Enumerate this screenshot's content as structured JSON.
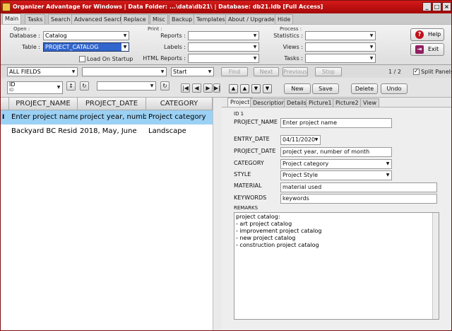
{
  "window": {
    "title": "Organizer Advantage for Windows | Data Folder: ...\\data\\db21\\ | Database: db21.ldb [Full Access]"
  },
  "menu_tabs": [
    "Main",
    "Tasks",
    "Search",
    "Advanced Search",
    "Replace",
    "Misc",
    "Backup",
    "Templates",
    "About / Upgrade",
    "Hide"
  ],
  "ribbon": {
    "open": {
      "caption": "Open :",
      "database_label": "Database :",
      "database_value": "Catalog",
      "table_label": "Table :",
      "table_value": "PROJECT_CATALOG",
      "load_on_startup_label": "Load On Startup",
      "load_on_startup_checked": false
    },
    "print": {
      "caption": "Print :",
      "reports_label": "Reports :",
      "labels_label": "Labels :",
      "html_reports_label": "HTML Reports :"
    },
    "process": {
      "caption": "Process :",
      "statistics_label": "Statistics :",
      "views_label": "Views :",
      "tasks_label": "Tasks :"
    },
    "help_label": "Help",
    "exit_label": "Exit"
  },
  "search": {
    "field": "ALL FIELDS",
    "term": "",
    "mode": "Start",
    "find_label": "Find",
    "next_label": "Next",
    "previous_label": "Previous",
    "stop_label": "Stop",
    "record_counter": "1 / 2",
    "split_panels_label": "Split Panels",
    "split_panels_checked": true
  },
  "left_toolbar": {
    "sort_field": "ID",
    "sort_field_sub": "ID",
    "filter_value": ""
  },
  "grid": {
    "columns": [
      "PROJECT_NAME",
      "PROJECT_DATE",
      "CATEGORY"
    ],
    "rows": [
      {
        "marker": "I",
        "cells": [
          "Enter project name",
          "project year, number",
          "Project category"
        ],
        "selected": true
      },
      {
        "marker": "",
        "cells": [
          "Backyard BC Residen",
          "2018, May, June",
          "Landscape"
        ],
        "selected": false
      }
    ]
  },
  "record_toolbar": {
    "new_label": "New",
    "save_label": "Save",
    "delete_label": "Delete",
    "undo_label": "Undo"
  },
  "form_tabs": [
    "Project",
    "Description",
    "Details",
    "Picture1",
    "Picture2",
    "View"
  ],
  "form": {
    "id_label": "ID 1",
    "project_name_label": "PROJECT_NAME",
    "project_name_value": "Enter project name",
    "entry_date_label": "ENTRY_DATE",
    "entry_date_value": "04/11/2020",
    "project_date_label": "PROJECT_DATE",
    "project_date_value": "project year, number of month",
    "category_label": "CATEGORY",
    "category_value": "Project category",
    "style_label": "STYLE",
    "style_value": "Project Style",
    "material_label": "MATERIAL",
    "material_value": "material used",
    "keywords_label": "KEYWORDS",
    "keywords_value": "keywords",
    "remarks_label": "REMARKS",
    "remarks_lines": [
      "project catalog:",
      " - art project catalog",
      " - improvement project catalog",
      " - new project catalog",
      " - construction project catalog"
    ]
  }
}
